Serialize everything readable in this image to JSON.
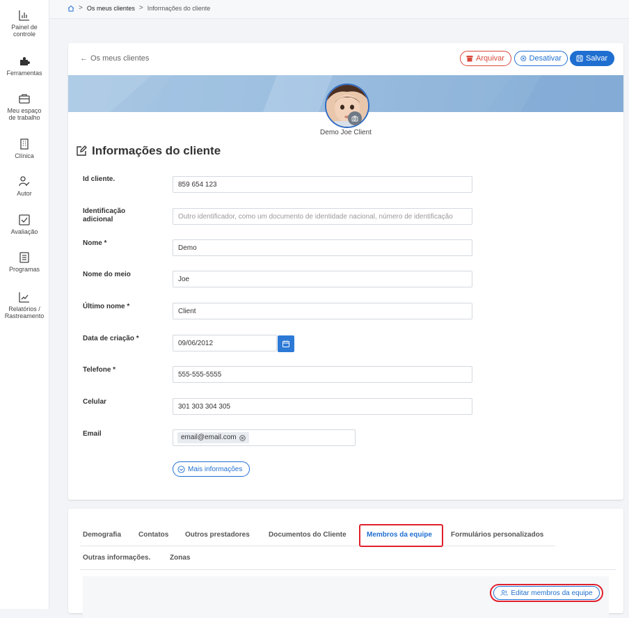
{
  "sidebar": {
    "items": [
      {
        "label": "Painel de\ncontrole",
        "icon": "dashboard-chart-icon"
      },
      {
        "label": "Ferramentas",
        "icon": "puzzle-icon"
      },
      {
        "label": "Meu espaço\nde trabalho",
        "icon": "briefcase-icon"
      },
      {
        "label": "Clínica",
        "icon": "building-icon"
      },
      {
        "label": "Autor",
        "icon": "author-icon"
      },
      {
        "label": "Avaliação",
        "icon": "checkbox-icon"
      },
      {
        "label": "Programas",
        "icon": "list-icon"
      },
      {
        "label": "Relatórios /\nRastreamento",
        "icon": "trend-chart-icon"
      }
    ]
  },
  "breadcrumb": {
    "home_icon": "home-icon",
    "link": "Os meus clientes",
    "current": "Informações do cliente"
  },
  "header": {
    "back_label": "Os meus clientes",
    "archive_label": "Arquivar",
    "deactivate_label": "Desativar",
    "save_label": "Salvar"
  },
  "profile": {
    "name": "Demo Joe Client"
  },
  "section": {
    "title": "Informações do cliente"
  },
  "fields": {
    "client_id": {
      "label": "Id cliente.",
      "value": "859 654 123"
    },
    "additional_id": {
      "label": "Identificação adicional",
      "placeholder": "Outro identificador, como um documento de identidade nacional, número de identificação"
    },
    "first_name": {
      "label": "Nome *",
      "value": "Demo"
    },
    "middle_name": {
      "label": "Nome do meio",
      "value": "Joe"
    },
    "last_name": {
      "label": "Último nome *",
      "value": "Client"
    },
    "created_date": {
      "label": "Data de criação *",
      "value": "09/06/2012"
    },
    "phone": {
      "label": "Telefone *",
      "value": "555-555-5555"
    },
    "mobile": {
      "label": "Celular",
      "value": "301 303 304 305"
    },
    "email": {
      "label": "Email",
      "value": "email@email.com"
    }
  },
  "more_info_label": "Mais informações",
  "tabs": {
    "row1": [
      "Demografia",
      "Contatos",
      "Outros prestadores",
      "Documentos do Cliente",
      "Membros da equipe",
      "Formulários personalizados"
    ],
    "row2": [
      "Outras informações.",
      "Zonas"
    ],
    "active": "Membros da equipe"
  },
  "team_panel": {
    "edit_button_label": "Editar membros da equipe"
  },
  "colors": {
    "primary": "#1f6fd1",
    "danger": "#d9483b",
    "highlight": "#e0202b"
  }
}
